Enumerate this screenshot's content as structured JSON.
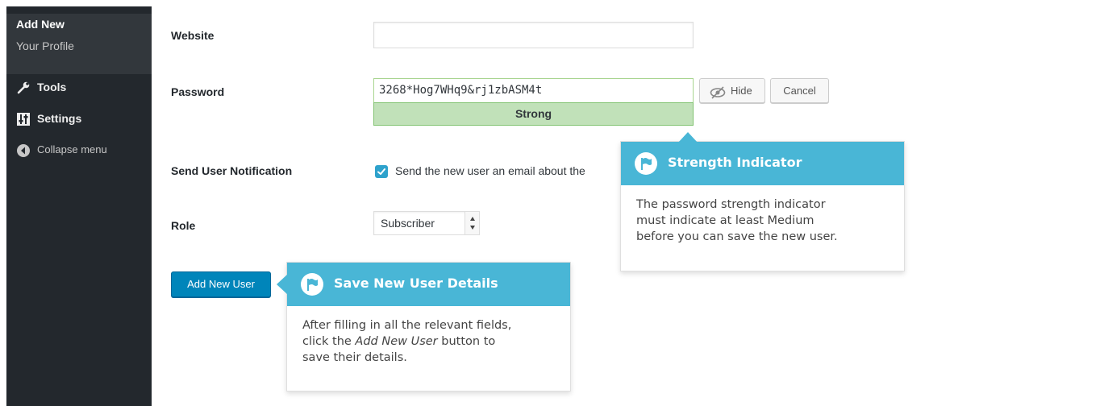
{
  "sidebar": {
    "submenu": {
      "add_new": "Add New",
      "your_profile": "Your Profile"
    },
    "items": [
      {
        "label": "Tools",
        "icon": "wrench-icon"
      },
      {
        "label": "Settings",
        "icon": "settings-icon"
      },
      {
        "label": "Collapse menu",
        "icon": "collapse-icon"
      }
    ]
  },
  "form": {
    "website": {
      "label": "Website",
      "value": ""
    },
    "password": {
      "label": "Password",
      "value": "3268*Hog7WHq9&rj1zbASM4t",
      "strength": "Strong",
      "hide_label": "Hide",
      "cancel_label": "Cancel"
    },
    "notification": {
      "label": "Send User Notification",
      "checkbox_label": "Send the new user an email about the",
      "checked": true
    },
    "role": {
      "label": "Role",
      "selected": "Subscriber"
    },
    "submit_label": "Add New User"
  },
  "pointers": {
    "strength": {
      "title": "Strength Indicator",
      "lines": [
        "The password strength indicator",
        "must indicate at least Medium",
        "before you can save the new user."
      ]
    },
    "save": {
      "title": "Save New User Details",
      "line1": "After filling in all the relevant fields,",
      "line2_prefix": "click the ",
      "line2_em": "Add New User",
      "line2_suffix": " button to",
      "line3": "save their details."
    }
  },
  "colors": {
    "sidebar_bg": "#23282d",
    "submenu_bg": "#32373c",
    "primary": "#0085ba",
    "pointer_header": "#49b6d6",
    "strength_bg": "#c1e1b9"
  }
}
